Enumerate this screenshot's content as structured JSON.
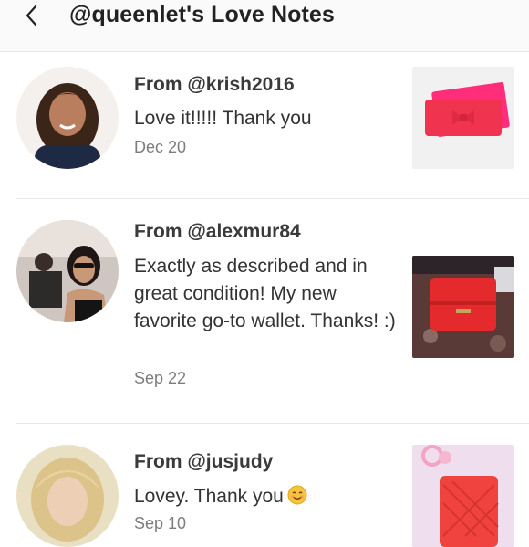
{
  "header": {
    "title": "@queenlet's Love Notes",
    "back_icon": "chevron-left-icon"
  },
  "notes": [
    {
      "from": "From @krish2016",
      "message": "Love it!!!!! Thank you",
      "date": "Dec 20"
    },
    {
      "from": "From @alexmur84",
      "message": "Exactly as described and in great condition! My new favorite go-to wallet. Thanks! :)",
      "date": "Sep 22"
    },
    {
      "from": "From @jusjudy",
      "message": "Lovey. Thank you",
      "emoji": "smiling-face-emoji",
      "date": "Sep 10"
    }
  ],
  "colors": {
    "header_bg": "#fafafa",
    "divider": "#e8e8e8",
    "date_text": "#7d7d7d"
  }
}
